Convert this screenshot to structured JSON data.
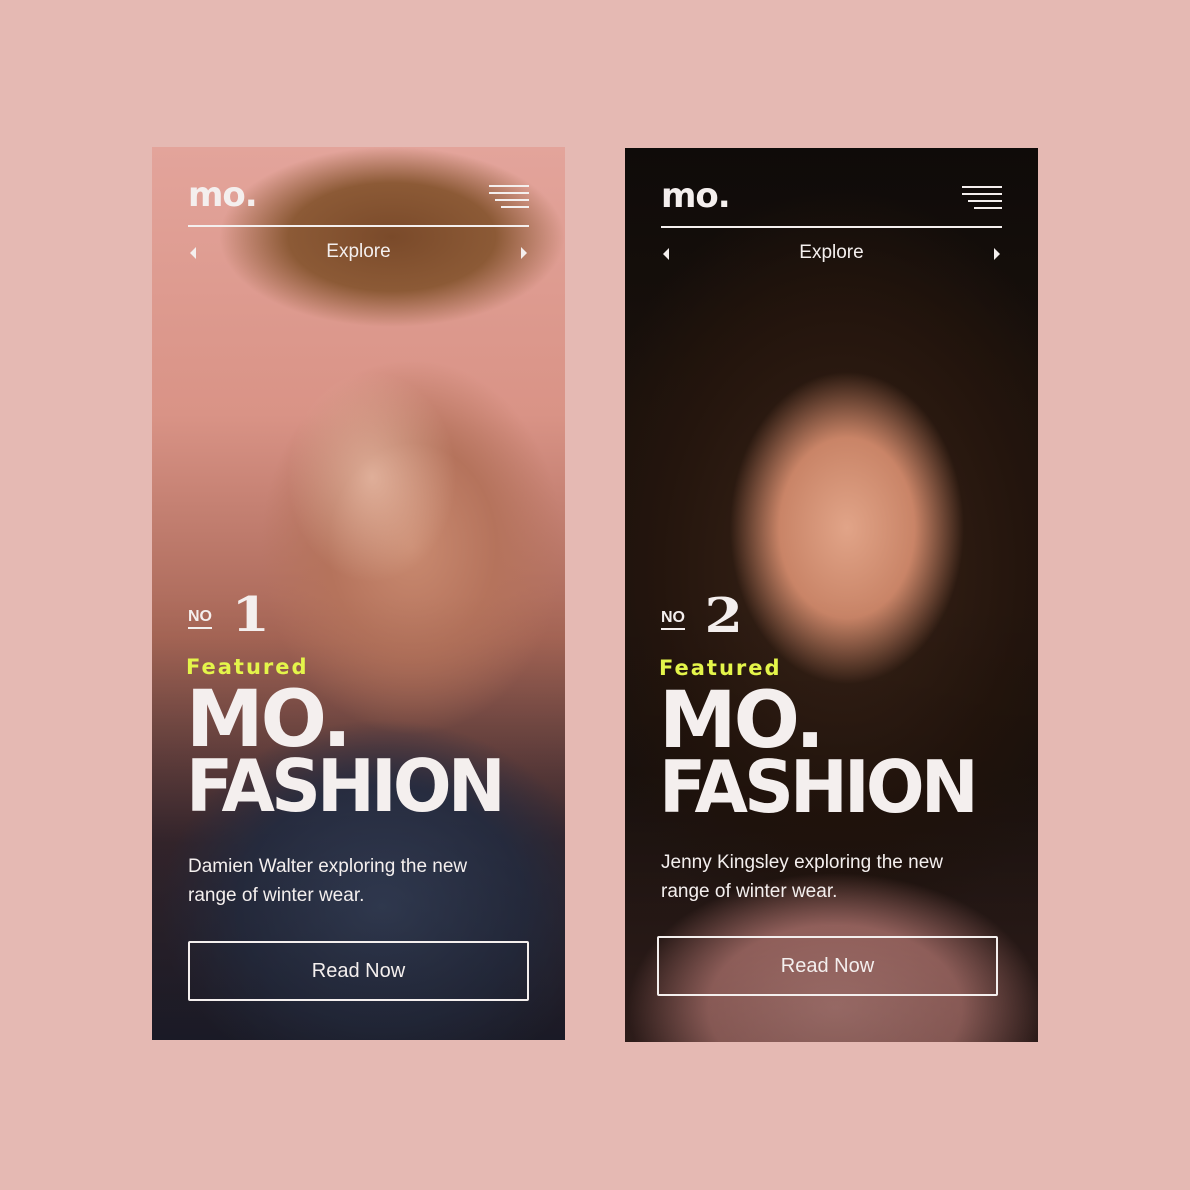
{
  "cards": [
    {
      "logo": "mo.",
      "nav_label": "Explore",
      "no_label": "NO",
      "number": "1",
      "featured": "Featured",
      "title_line1": "MO.",
      "title_line2": "FASHION",
      "description": "Damien Walter exploring the new range of winter wear.",
      "button_label": "Read Now"
    },
    {
      "logo": "mo.",
      "nav_label": "Explore",
      "no_label": "NO",
      "number": "2",
      "featured": "Featured",
      "title_line1": "MO.",
      "title_line2": "FASHION",
      "description": "Jenny Kingsley exploring the new range of winter wear.",
      "button_label": "Read Now"
    }
  ],
  "colors": {
    "background": "#e5b9b3",
    "accent": "#e4f54a",
    "text": "#f4efee"
  },
  "icons": [
    "hamburger-menu-icon",
    "caret-left-icon",
    "caret-right-icon"
  ]
}
